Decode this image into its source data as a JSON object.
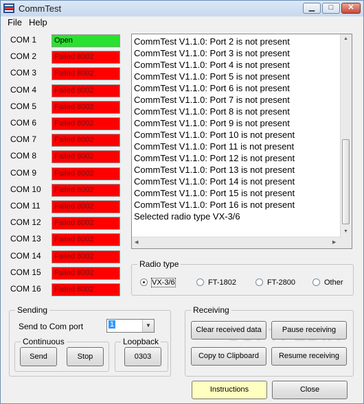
{
  "window": {
    "title": "CommTest"
  },
  "menu": {
    "file": "File",
    "help": "Help"
  },
  "ports": [
    {
      "label": "COM 1",
      "status": "Open"
    },
    {
      "label": "COM 2",
      "status": "Failed 8002"
    },
    {
      "label": "COM 3",
      "status": "Failed 8002"
    },
    {
      "label": "COM 4",
      "status": "Failed 8002"
    },
    {
      "label": "COM 5",
      "status": "Failed 8002"
    },
    {
      "label": "COM 6",
      "status": "Failed 8002"
    },
    {
      "label": "COM 7",
      "status": "Failed 8002"
    },
    {
      "label": "COM 8",
      "status": "Failed 8002"
    },
    {
      "label": "COM 9",
      "status": "Failed 8002"
    },
    {
      "label": "COM 10",
      "status": "Failed 8002"
    },
    {
      "label": "COM 11",
      "status": "Failed 8002"
    },
    {
      "label": "COM 12",
      "status": "Failed 8002"
    },
    {
      "label": "COM 13",
      "status": "Failed 8002"
    },
    {
      "label": "COM 14",
      "status": "Failed 8002"
    },
    {
      "label": "COM 15",
      "status": "Failed 8002"
    },
    {
      "label": "COM 16",
      "status": "Failed 8002"
    }
  ],
  "log": [
    "CommTest V1.1.0: Port 2 is not present",
    "CommTest V1.1.0: Port 3 is not present",
    "CommTest V1.1.0: Port 4 is not present",
    "CommTest V1.1.0: Port 5 is not present",
    "CommTest V1.1.0: Port 6 is not present",
    "CommTest V1.1.0: Port 7 is not present",
    "CommTest V1.1.0: Port 8 is not present",
    "CommTest V1.1.0: Port 9 is not present",
    "CommTest V1.1.0: Port 10 is not present",
    "CommTest V1.1.0: Port 11 is not present",
    "CommTest V1.1.0: Port 12 is not present",
    "CommTest V1.1.0: Port 13 is not present",
    "CommTest V1.1.0: Port 14 is not present",
    "CommTest V1.1.0: Port 15 is not present",
    "CommTest V1.1.0: Port 16 is not present",
    "Selected radio type VX-3/6"
  ],
  "radio_type": {
    "title": "Radio type",
    "options": [
      "VX-3/6",
      "FT-1802",
      "FT-2800",
      "Other"
    ],
    "selected": "VX-3/6"
  },
  "sending": {
    "title": "Sending",
    "port_label": "Send to Com port",
    "port_value": "1",
    "continuous_title": "Continuous",
    "send": "Send",
    "stop": "Stop",
    "loopback_title": "Loopback",
    "loopback_value": "0303"
  },
  "receiving": {
    "title": "Receiving",
    "clear": "Clear received data",
    "pause": "Pause receiving",
    "copy": "Copy to Clipboard",
    "resume": "Resume receiving"
  },
  "footer": {
    "instructions": "Instructions",
    "close": "Close"
  },
  "colors": {
    "failed": "#ff0000",
    "open": "#29e12f",
    "instructions_bg": "#ffffc0"
  },
  "icons": [
    "minimize-icon",
    "maximize-icon",
    "close-icon",
    "dropdown-arrow-icon"
  ]
}
